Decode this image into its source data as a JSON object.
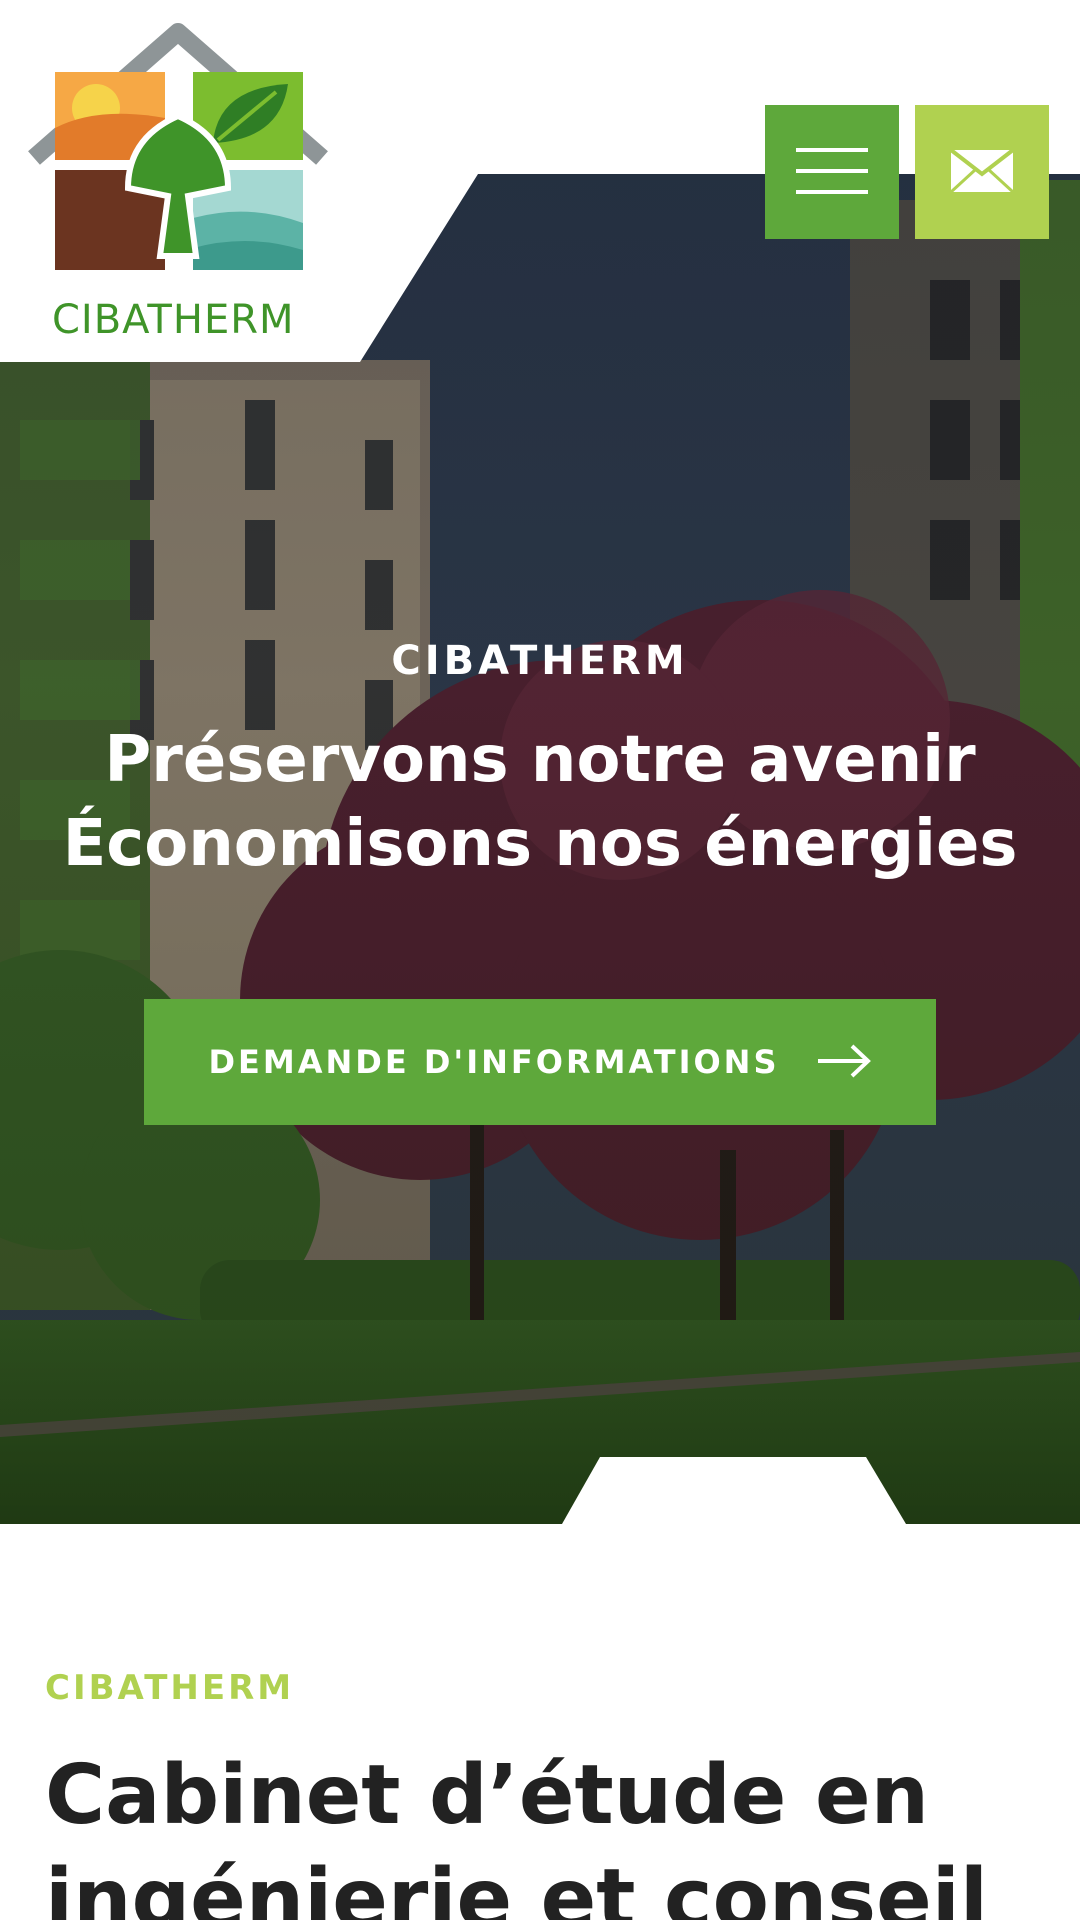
{
  "colors": {
    "primary_green": "#5ea83b",
    "light_green": "#b0d150",
    "logo_green": "#3f9429",
    "dark_text": "#222222",
    "white": "#ffffff"
  },
  "logo": {
    "text": "CIBATHERM",
    "icon": "house-leaf-logo"
  },
  "header": {
    "menu_icon": "hamburger-icon",
    "mail_icon": "envelope-icon"
  },
  "hero": {
    "kicker": "CIBATHERM",
    "title_line1": "Préservons notre avenir",
    "title_line2": "Économisons nos énergies",
    "cta_label": "DEMANDE D'INFORMATIONS",
    "cta_icon": "arrow-right-icon"
  },
  "intro": {
    "kicker": "CIBATHERM",
    "title": "Cabinet d’étude en ingénierie et conseil"
  }
}
